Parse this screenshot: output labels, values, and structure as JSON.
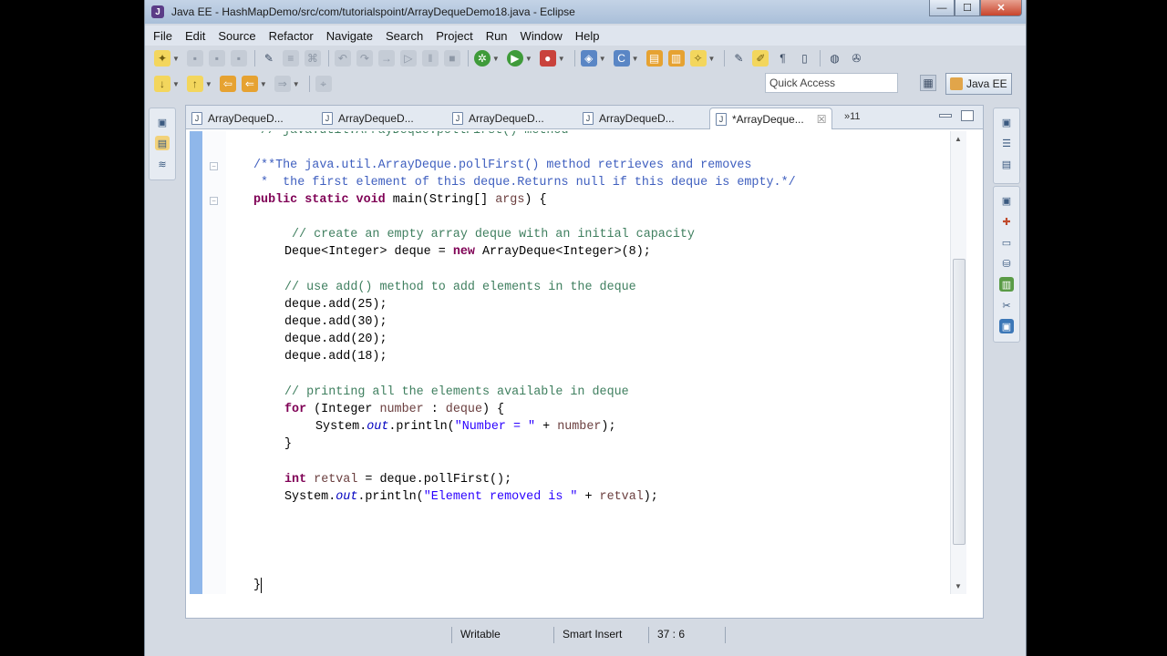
{
  "window": {
    "title": "Java EE - HashMapDemo/src/com/tutorialspoint/ArrayDequeDemo18.java - Eclipse",
    "app_icon": "J"
  },
  "window_controls": {
    "minimize": "—",
    "maximize": "☐",
    "close": "✕"
  },
  "menu": [
    "File",
    "Edit",
    "Source",
    "Refactor",
    "Navigate",
    "Search",
    "Project",
    "Run",
    "Window",
    "Help"
  ],
  "toolbar": {
    "quick_access_placeholder": "Quick Access",
    "perspective_label": "Java EE"
  },
  "tabs": [
    {
      "label": "ArrayDequeD...",
      "active": false
    },
    {
      "label": "ArrayDequeD...",
      "active": false
    },
    {
      "label": "ArrayDequeD...",
      "active": false
    },
    {
      "label": "ArrayDequeD...",
      "active": false
    },
    {
      "label": "*ArrayDeque...",
      "active": true
    }
  ],
  "tab_icon": "J",
  "tab_close": "☒",
  "tab_overflow": "»11",
  "code_lines": [
    "// java.util.ArrayDeque.pollFirst() method",
    "/**The java.util.ArrayDeque.pollFirst() method retrieves and removes",
    " *  the first element of this deque.Returns null if this deque is empty.*/",
    "public static void main(String[] args) {",
    "// create an empty array deque with an initial capacity",
    "Deque<Integer> deque = new ArrayDeque<Integer>(8);",
    "// use add() method to add elements in the deque",
    "deque.add(25);",
    "deque.add(30);",
    "deque.add(20);",
    "deque.add(18);",
    "// printing all the elements available in deque",
    "for (Integer number : deque) {",
    "System.out.println(\"Number = \" + number);",
    "}",
    "int retval = deque.pollFirst();",
    "System.out.println(\"Element removed is \" + retval);",
    "}"
  ],
  "status": {
    "writable": "Writable",
    "insert_mode": "Smart Insert",
    "position": "37 : 6"
  },
  "colors": {
    "comment": "#3f7f5f",
    "javadoc": "#3f5fbf",
    "keyword": "#7f0055",
    "string": "#2a00ff",
    "field": "#0000c0",
    "variable": "#6a3e3e",
    "selected_tab": "#ffffff",
    "chrome": "#d4dae3"
  }
}
